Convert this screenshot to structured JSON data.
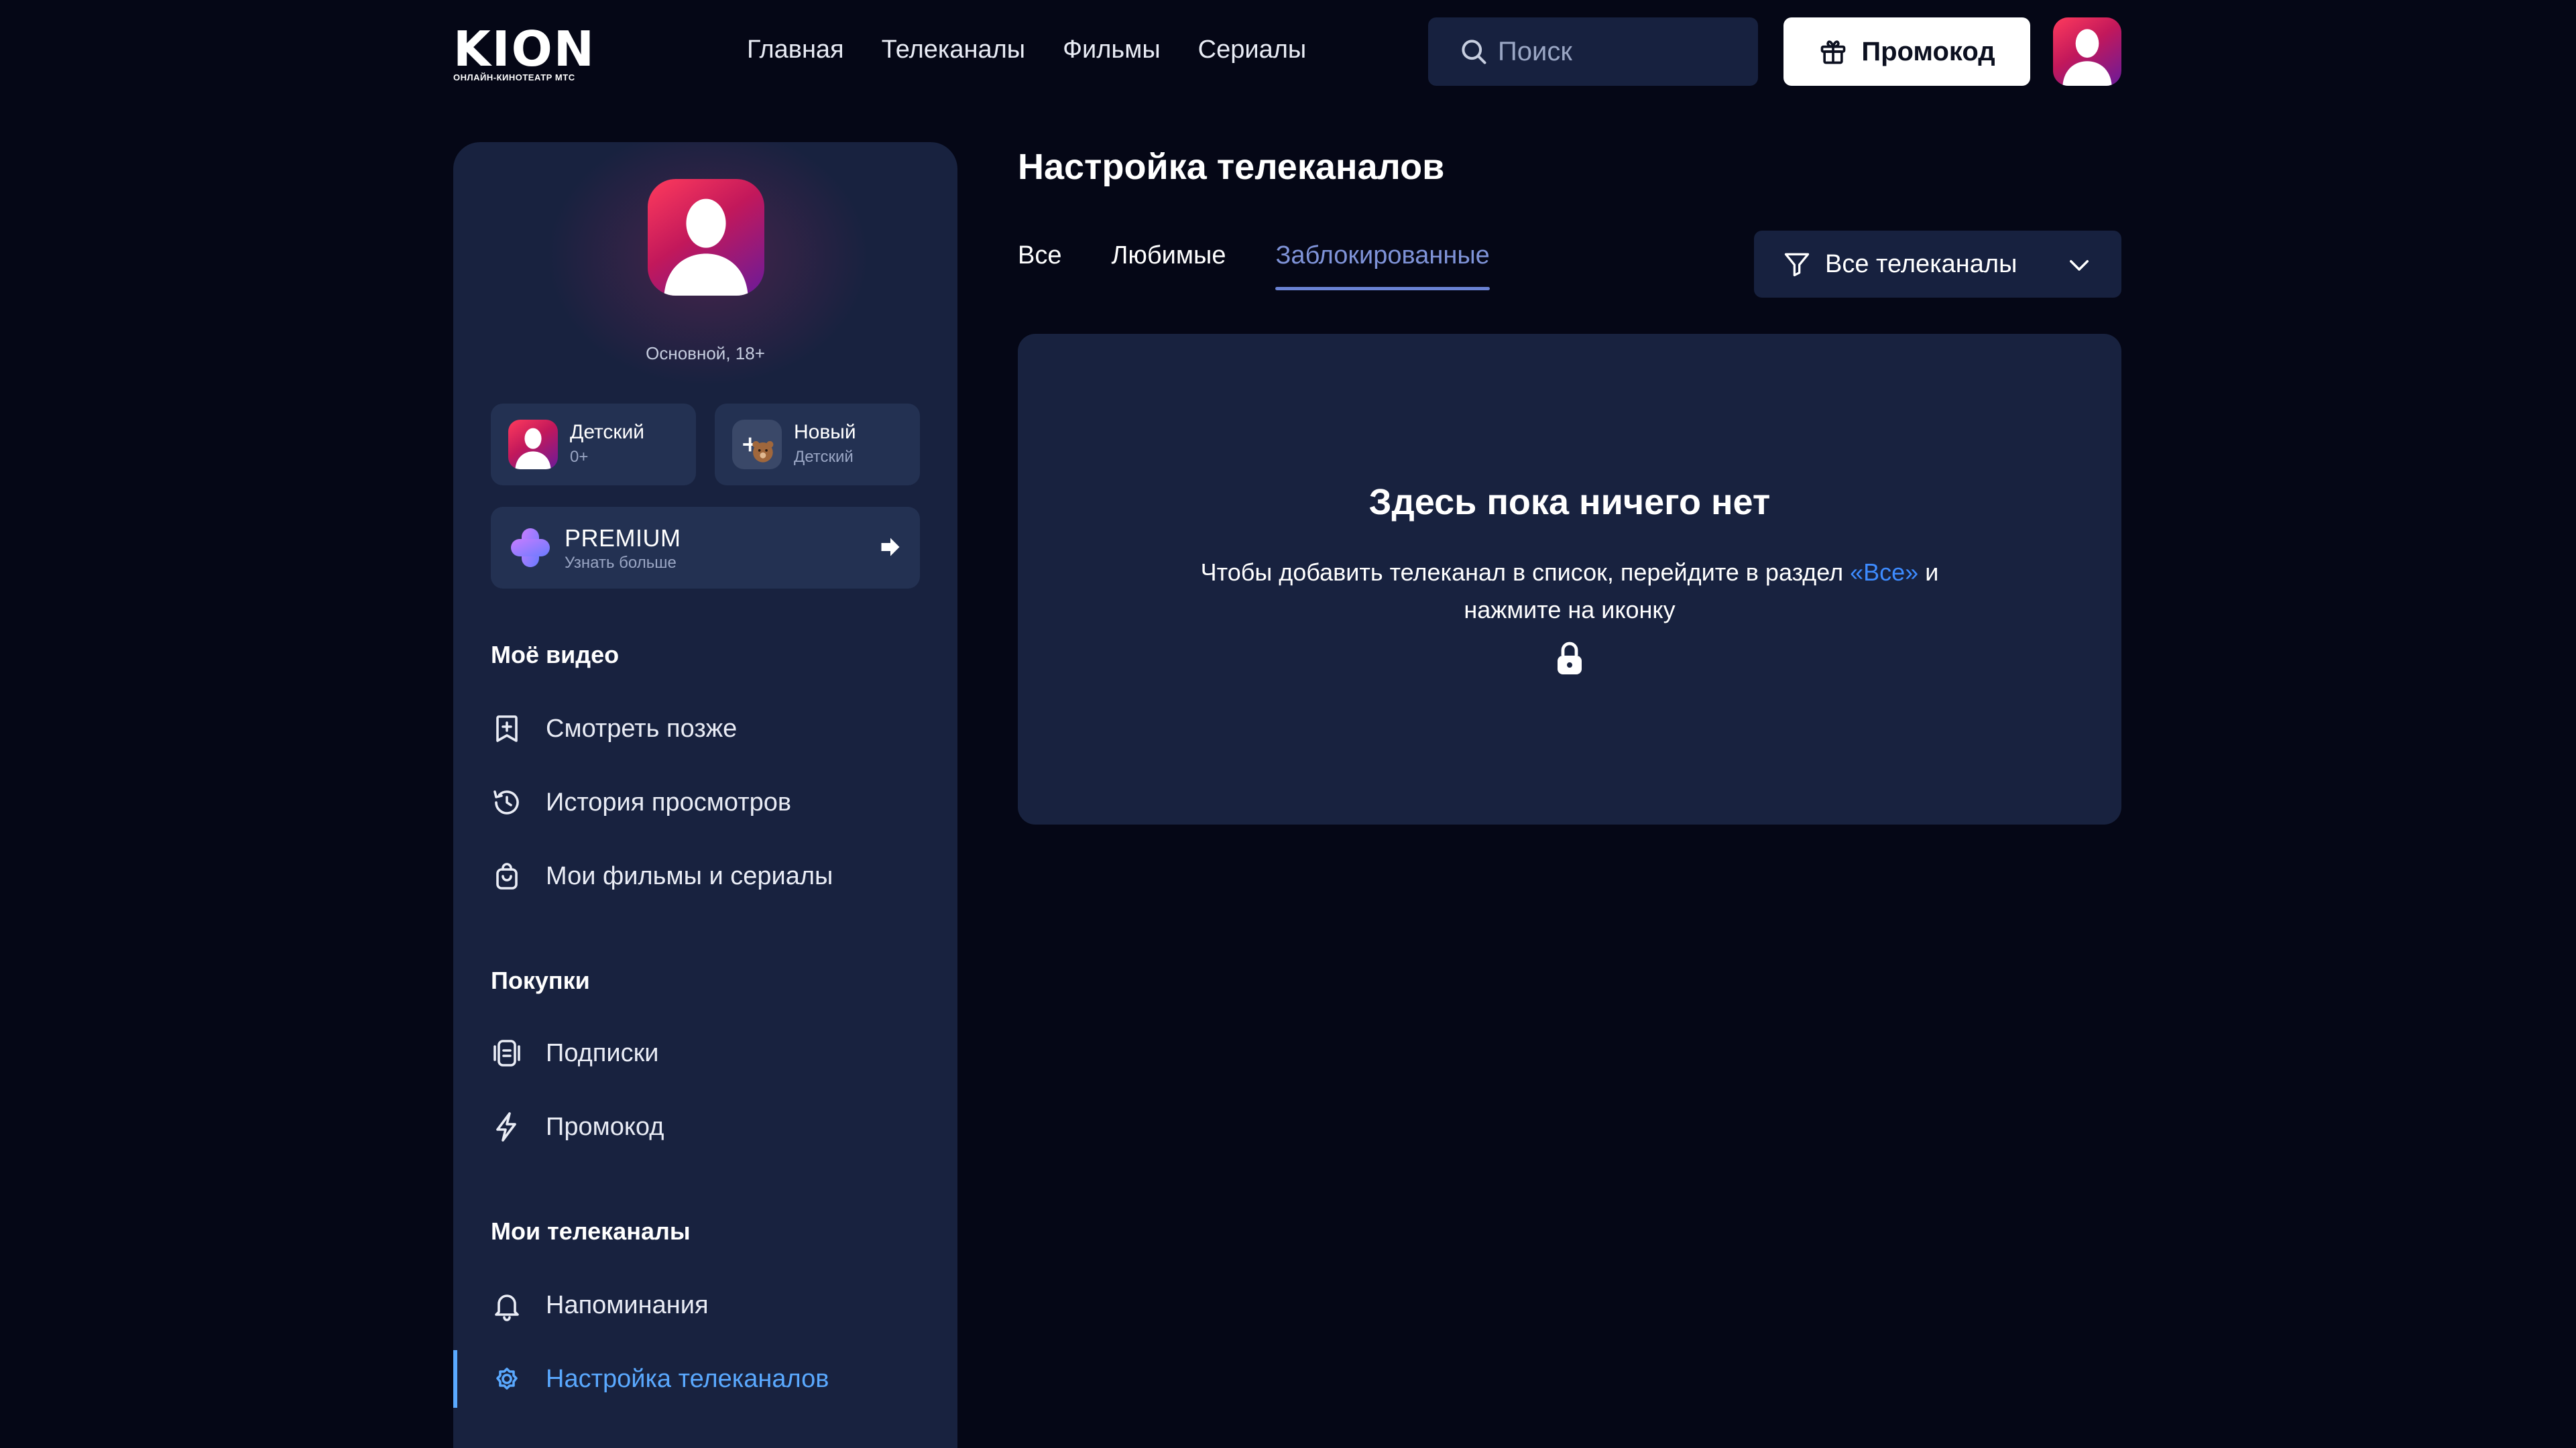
{
  "header": {
    "logo_text": "KION",
    "logo_subtitle": "ОНЛАЙН-КИНОТЕАТР МТС",
    "nav": [
      "Главная",
      "Телеканалы",
      "Фильмы",
      "Сериалы"
    ],
    "search_placeholder": "Поиск",
    "promo_label": "Промокод"
  },
  "sidebar": {
    "profile_name": "Основной, 18+",
    "profiles": [
      {
        "title": "Детский",
        "subtitle": "0+"
      },
      {
        "title": "Новый",
        "subtitle": "Детский"
      }
    ],
    "premium": {
      "title": "PREMIUM",
      "subtitle": "Узнать больше"
    },
    "sections": [
      {
        "title": "Моё видео",
        "items": [
          "Смотреть позже",
          "История просмотров",
          "Мои фильмы и сериалы"
        ]
      },
      {
        "title": "Покупки",
        "items": [
          "Подписки",
          "Промокод"
        ]
      },
      {
        "title": "Мои телеканалы",
        "items": [
          "Напоминания",
          "Настройка телеканалов"
        ]
      }
    ]
  },
  "main": {
    "title": "Настройка телеканалов",
    "tabs": [
      "Все",
      "Любимые",
      "Заблокированные"
    ],
    "active_tab": "Заблокированные",
    "filter_label": "Все телеканалы",
    "empty": {
      "title": "Здесь пока ничего нет",
      "text_before": "Чтобы добавить телеканал в список, перейдите в раздел ",
      "link": "«Все»",
      "text_after": " и нажмите на иконку"
    }
  },
  "colors": {
    "background": "#050716",
    "panel": "#18223f",
    "card": "#233152",
    "accent_link": "#3d8bff",
    "active_menu": "#5aa9ff",
    "active_tab": "#7f93d8"
  }
}
